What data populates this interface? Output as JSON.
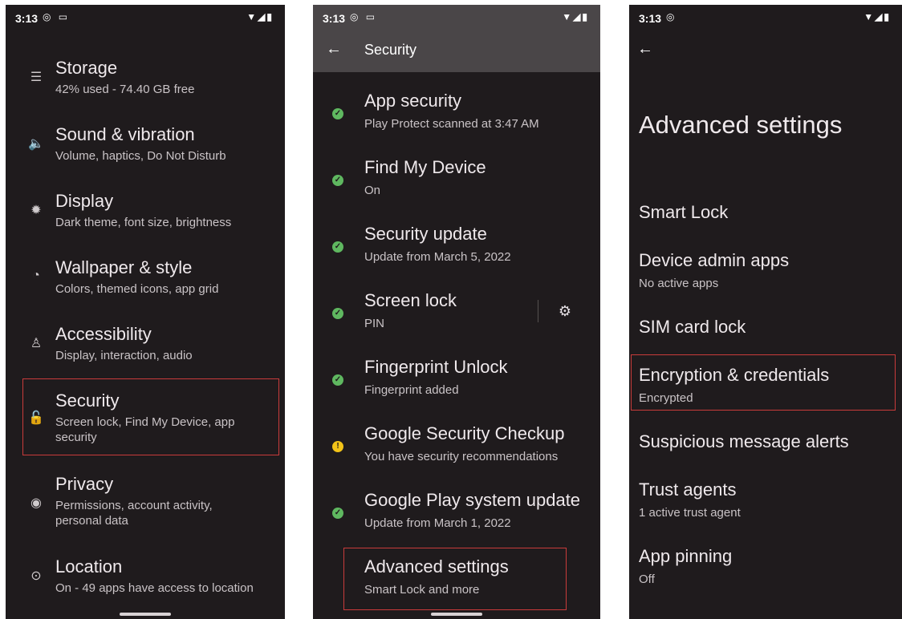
{
  "status": {
    "time": "3:13"
  },
  "panel1": {
    "items": [
      {
        "title": "Storage",
        "subtitle": "42% used - 74.40 GB free",
        "icon": "storage-icon"
      },
      {
        "title": "Sound & vibration",
        "subtitle": "Volume, haptics, Do Not Disturb",
        "icon": "speaker-icon"
      },
      {
        "title": "Display",
        "subtitle": "Dark theme, font size, brightness",
        "icon": "brightness-icon"
      },
      {
        "title": "Wallpaper & style",
        "subtitle": "Colors, themed icons, app grid",
        "icon": "palette-icon"
      },
      {
        "title": "Accessibility",
        "subtitle": "Display, interaction, audio",
        "icon": "accessibility-icon"
      },
      {
        "title": "Security",
        "subtitle": "Screen lock, Find My Device, app security",
        "icon": "lock-icon"
      },
      {
        "title": "Privacy",
        "subtitle": "Permissions, account activity, personal data",
        "icon": "privacy-eye-icon"
      },
      {
        "title": "Location",
        "subtitle": "On - 49 apps have access to location",
        "icon": "location-pin-icon"
      }
    ]
  },
  "panel2": {
    "header": {
      "title": "Security"
    },
    "items": [
      {
        "title": "App security",
        "subtitle": "Play Protect scanned at 3:47 AM",
        "status": "ok"
      },
      {
        "title": "Find My Device",
        "subtitle": "On",
        "status": "ok"
      },
      {
        "title": "Security update",
        "subtitle": "Update from March 5, 2022",
        "status": "ok"
      },
      {
        "title": "Screen lock",
        "subtitle": "PIN",
        "status": "ok"
      },
      {
        "title": "Fingerprint Unlock",
        "subtitle": "Fingerprint added",
        "status": "ok"
      },
      {
        "title": "Google Security Checkup",
        "subtitle": "You have security recommendations",
        "status": "warning"
      },
      {
        "title": "Google Play system update",
        "subtitle": "Update from March 1, 2022",
        "status": "ok"
      },
      {
        "title": "Advanced settings",
        "subtitle": "Smart Lock and more"
      }
    ]
  },
  "panel3": {
    "title": "Advanced settings",
    "items": [
      {
        "title": "Smart Lock",
        "subtitle": ""
      },
      {
        "title": "Device admin apps",
        "subtitle": "No active apps"
      },
      {
        "title": "SIM card lock",
        "subtitle": ""
      },
      {
        "title": "Encryption & credentials",
        "subtitle": "Encrypted"
      },
      {
        "title": "Suspicious message alerts",
        "subtitle": ""
      },
      {
        "title": "Trust agents",
        "subtitle": "1 active trust agent"
      },
      {
        "title": "App pinning",
        "subtitle": "Off"
      }
    ]
  },
  "colors": {
    "background": "#1f1b1d",
    "highlight": "#c93b3b",
    "ok": "#5fb860",
    "warning": "#f2c318",
    "appbar": "#4a4648"
  }
}
